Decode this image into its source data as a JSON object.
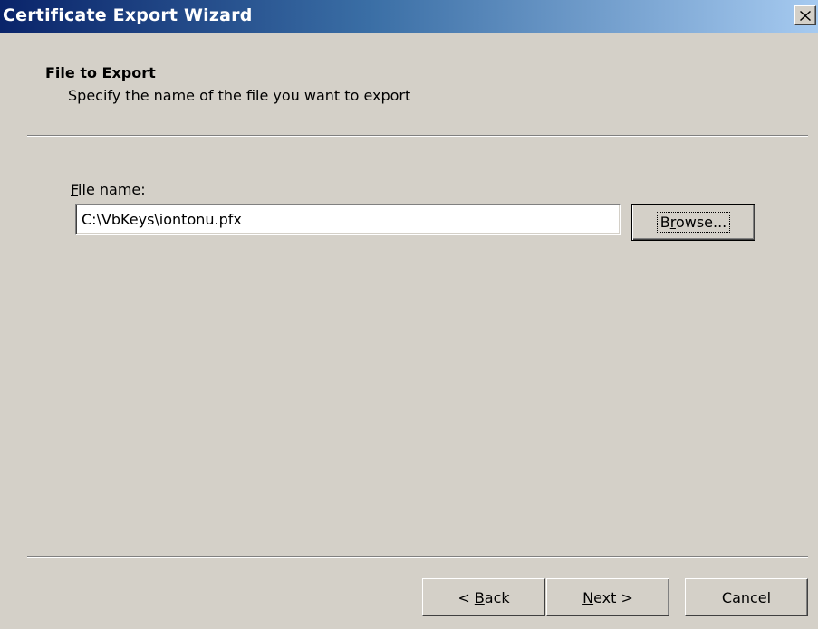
{
  "window": {
    "title": "Certificate Export Wizard",
    "close_icon": "close-icon"
  },
  "header": {
    "title": "File to Export",
    "subtitle": "Specify the name of the file you want to export"
  },
  "form": {
    "file_name_label_mnemonic": "F",
    "file_name_label_rest": "ile name:",
    "file_name_value": "C:\\VbKeys\\iontonu.pfx",
    "browse_pre": "B",
    "browse_mnemonic": "r",
    "browse_post": "owse..."
  },
  "footer": {
    "back_pre": "< ",
    "back_mnemonic": "B",
    "back_post": "ack",
    "next_mnemonic": "N",
    "next_post": "ext >",
    "cancel": "Cancel"
  }
}
